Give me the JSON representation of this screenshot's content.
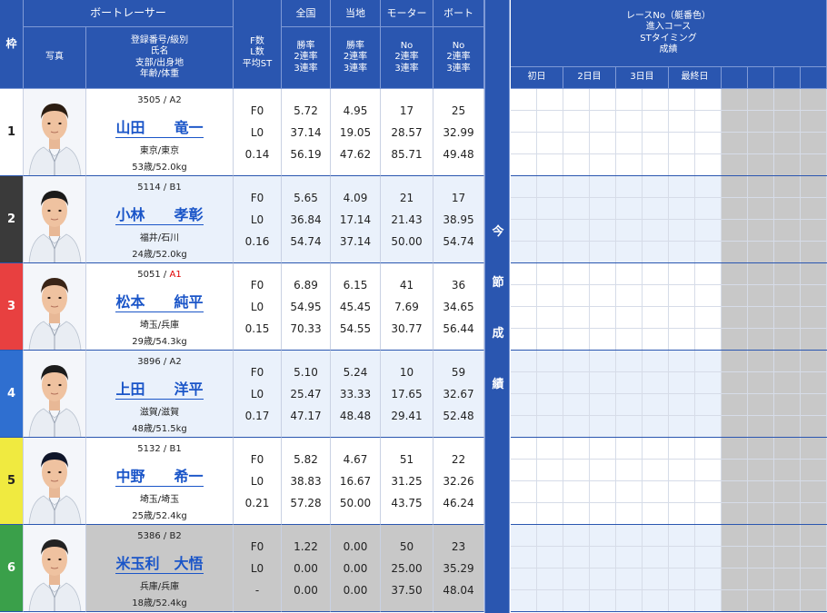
{
  "header": {
    "waku": "枠",
    "boat_racer": "ボートレーサー",
    "photo": "写真",
    "info_lines": [
      "登録番号/級別",
      "氏名",
      "支部/出身地",
      "年齢/体重"
    ],
    "f_lines": [
      "F数",
      "L数",
      "平均ST"
    ],
    "zenkoku": "全国",
    "touchi": "当地",
    "motor": "モーター",
    "boat": "ボート",
    "rate_lines": [
      "勝率",
      "2連率",
      "3連率"
    ],
    "no_lines": [
      "No",
      "2連率",
      "3連率"
    ],
    "race_lines": [
      "レースNo（艇番色）",
      "進入コース",
      "STタイミング",
      "成績"
    ],
    "days": [
      "初日",
      "2日目",
      "3日目",
      "最終日"
    ],
    "konsetsu": [
      "今",
      "節",
      "成",
      "績"
    ]
  },
  "colors": {
    "header_bg": "#2a56b0",
    "name_link": "#1a55c8",
    "row_bg_a": "#ffffff",
    "row_bg_b": "#eaf1fb",
    "b2_bg": "#c8c8c8",
    "grid_blank": "#c8c8c8",
    "class_a1": "#e00000"
  },
  "racers": [
    {
      "waku": "1",
      "waku_bg": "#ffffff",
      "waku_fg": "#222222",
      "reg": "3505",
      "class": "A2",
      "name": "山田　　竜一",
      "pref": "東京/東京",
      "age_weight": "53歳/52.0kg",
      "f": "F0",
      "l": "L0",
      "st": "0.14",
      "zen": [
        "5.72",
        "37.14",
        "56.19"
      ],
      "tou": [
        "4.95",
        "19.05",
        "47.62"
      ],
      "motor": [
        "17",
        "28.57",
        "85.71"
      ],
      "boat": [
        "25",
        "32.99",
        "49.48"
      ],
      "photo_icon": "racer-photo",
      "hair": "#2b1d12"
    },
    {
      "waku": "2",
      "waku_bg": "#3a3a3a",
      "waku_fg": "#ffffff",
      "reg": "5114",
      "class": "B1",
      "name": "小林　　孝彰",
      "pref": "福井/石川",
      "age_weight": "24歳/52.0kg",
      "f": "F0",
      "l": "L0",
      "st": "0.16",
      "zen": [
        "5.65",
        "36.84",
        "54.74"
      ],
      "tou": [
        "4.09",
        "17.14",
        "37.14"
      ],
      "motor": [
        "21",
        "21.43",
        "50.00"
      ],
      "boat": [
        "17",
        "38.95",
        "54.74"
      ],
      "photo_icon": "racer-photo",
      "hair": "#1a1a1a"
    },
    {
      "waku": "3",
      "waku_bg": "#e84040",
      "waku_fg": "#ffffff",
      "reg": "5051",
      "class": "A1",
      "name": "松本　　純平",
      "pref": "埼玉/兵庫",
      "age_weight": "29歳/54.3kg",
      "f": "F0",
      "l": "L0",
      "st": "0.15",
      "zen": [
        "6.89",
        "54.95",
        "70.33"
      ],
      "tou": [
        "6.15",
        "45.45",
        "54.55"
      ],
      "motor": [
        "41",
        "7.69",
        "30.77"
      ],
      "boat": [
        "36",
        "34.65",
        "56.44"
      ],
      "photo_icon": "racer-photo",
      "hair": "#3a2416"
    },
    {
      "waku": "4",
      "waku_bg": "#2f6fd0",
      "waku_fg": "#ffffff",
      "reg": "3896",
      "class": "A2",
      "name": "上田　　洋平",
      "pref": "滋賀/滋賀",
      "age_weight": "48歳/51.5kg",
      "f": "F0",
      "l": "L0",
      "st": "0.17",
      "zen": [
        "5.10",
        "25.47",
        "47.17"
      ],
      "tou": [
        "5.24",
        "33.33",
        "48.48"
      ],
      "motor": [
        "10",
        "17.65",
        "29.41"
      ],
      "boat": [
        "59",
        "32.67",
        "52.48"
      ],
      "photo_icon": "racer-photo",
      "hair": "#1c1c1c"
    },
    {
      "waku": "5",
      "waku_bg": "#f0ea40",
      "waku_fg": "#222222",
      "reg": "5132",
      "class": "B1",
      "name": "中野　　希一",
      "pref": "埼玉/埼玉",
      "age_weight": "25歳/52.4kg",
      "f": "F0",
      "l": "L0",
      "st": "0.21",
      "zen": [
        "5.82",
        "38.83",
        "57.28"
      ],
      "tou": [
        "4.67",
        "16.67",
        "50.00"
      ],
      "motor": [
        "51",
        "31.25",
        "43.75"
      ],
      "boat": [
        "22",
        "32.26",
        "46.24"
      ],
      "photo_icon": "racer-photo",
      "hair": "#10162a"
    },
    {
      "waku": "6",
      "waku_bg": "#3aa04a",
      "waku_fg": "#ffffff",
      "reg": "5386",
      "class": "B2",
      "name": "米玉利　大悟",
      "pref": "兵庫/兵庫",
      "age_weight": "18歳/52.4kg",
      "f": "F0",
      "l": "L0",
      "st": "-",
      "zen": [
        "1.22",
        "0.00",
        "0.00"
      ],
      "tou": [
        "0.00",
        "0.00",
        "0.00"
      ],
      "motor": [
        "50",
        "25.00",
        "37.50"
      ],
      "boat": [
        "23",
        "35.29",
        "48.04"
      ],
      "photo_icon": "racer-photo",
      "hair": "#222222"
    }
  ]
}
